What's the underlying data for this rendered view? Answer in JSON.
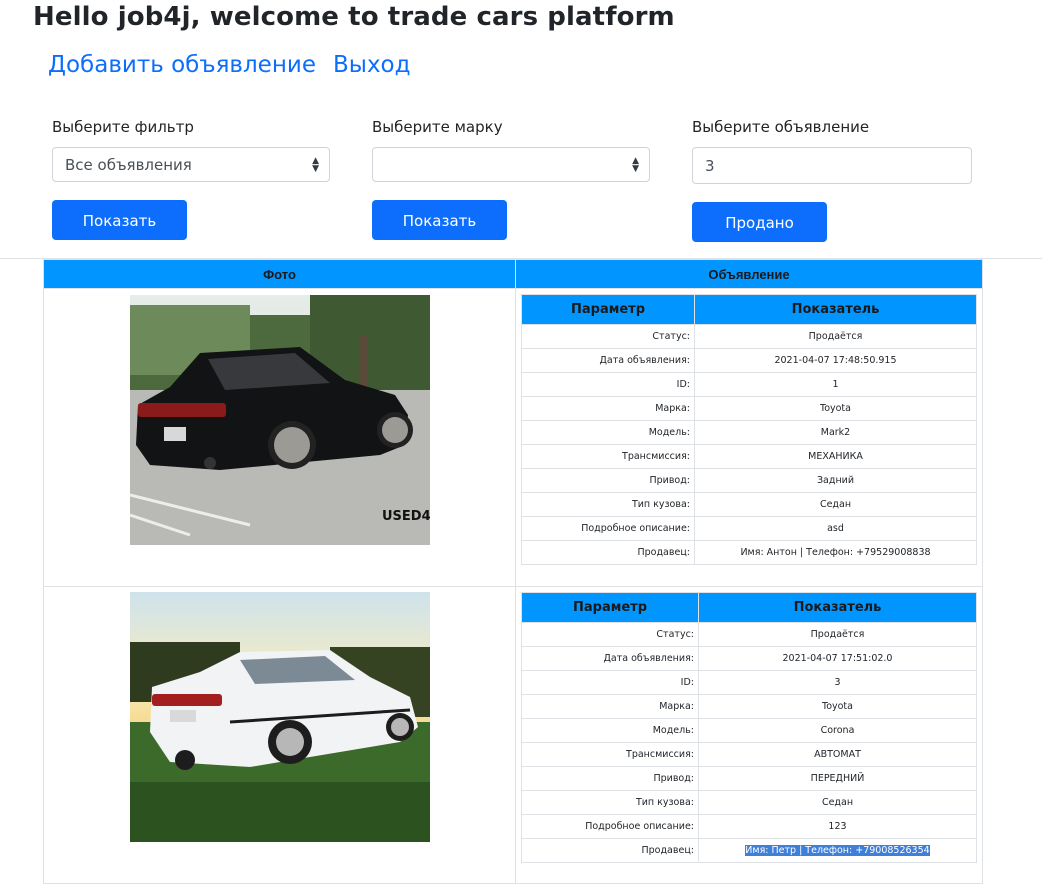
{
  "header": {
    "title": "Hello job4j, welcome to trade cars platform",
    "add_link": "Добавить объявление",
    "logout_link": "Выход"
  },
  "filters": {
    "filter": {
      "label": "Выберите фильтр",
      "selected": "Все объявления",
      "button": "Показать"
    },
    "brand": {
      "label": "Выберите марку",
      "selected": "",
      "button": "Показать"
    },
    "ad": {
      "label": "Выберите объявление",
      "value": "3",
      "button": "Продано"
    }
  },
  "table": {
    "col_photo": "Фото",
    "col_ad": "Объявление",
    "detail_headers": {
      "param": "Параметр",
      "value": "Показатель"
    },
    "ads": [
      {
        "rows": [
          {
            "param": "Статус:",
            "value": "Продаётся"
          },
          {
            "param": "Дата объявления:",
            "value": "2021-04-07 17:48:50.915"
          },
          {
            "param": "ID:",
            "value": "1"
          },
          {
            "param": "Марка:",
            "value": "Toyota"
          },
          {
            "param": "Модель:",
            "value": "Mark2"
          },
          {
            "param": "Трансмиссия:",
            "value": "МЕХАНИКА"
          },
          {
            "param": "Привод:",
            "value": "Задний"
          },
          {
            "param": "Тип кузова:",
            "value": "Седан"
          },
          {
            "param": "Подробное описание:",
            "value": "asd"
          },
          {
            "param": "Продавец:",
            "value": "Имя: Антон | Телефон: +79529008838"
          }
        ],
        "watermark": "USED4"
      },
      {
        "rows": [
          {
            "param": "Статус:",
            "value": "Продаётся"
          },
          {
            "param": "Дата объявления:",
            "value": "2021-04-07 17:51:02.0"
          },
          {
            "param": "ID:",
            "value": "3"
          },
          {
            "param": "Марка:",
            "value": "Toyota"
          },
          {
            "param": "Модель:",
            "value": "Corona"
          },
          {
            "param": "Трансмиссия:",
            "value": "АВТОМАТ"
          },
          {
            "param": "Привод:",
            "value": "ПЕРЕДНИЙ"
          },
          {
            "param": "Тип кузова:",
            "value": "Седан"
          },
          {
            "param": "Подробное описание:",
            "value": "123"
          },
          {
            "param": "Продавец:",
            "value": "Имя: Петр | Телефон: +79008526354"
          }
        ]
      }
    ]
  },
  "colors": {
    "accent": "#0d6efd",
    "table_header": "#0095ff",
    "selection": "#3d7fd9"
  }
}
